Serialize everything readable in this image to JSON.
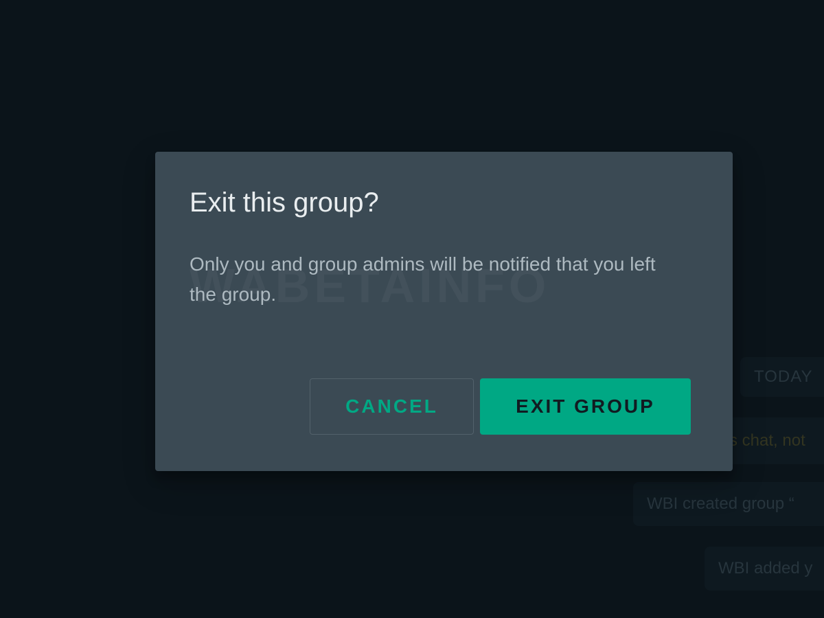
{
  "background": {
    "date_chip": "TODAY",
    "encryption_note": "s chat, not",
    "system_messages": [
      "WBI created group “",
      "WBI added y"
    ]
  },
  "dialog": {
    "title": "Exit this group?",
    "body": "Only you and group admins will be notified that you left the group.",
    "watermark": "WABETAINFO",
    "cancel_label": "CANCEL",
    "confirm_label": "EXIT GROUP"
  },
  "colors": {
    "accent": "#00a884",
    "dialog_bg": "#3b4a54",
    "app_bg": "#0b141a"
  }
}
